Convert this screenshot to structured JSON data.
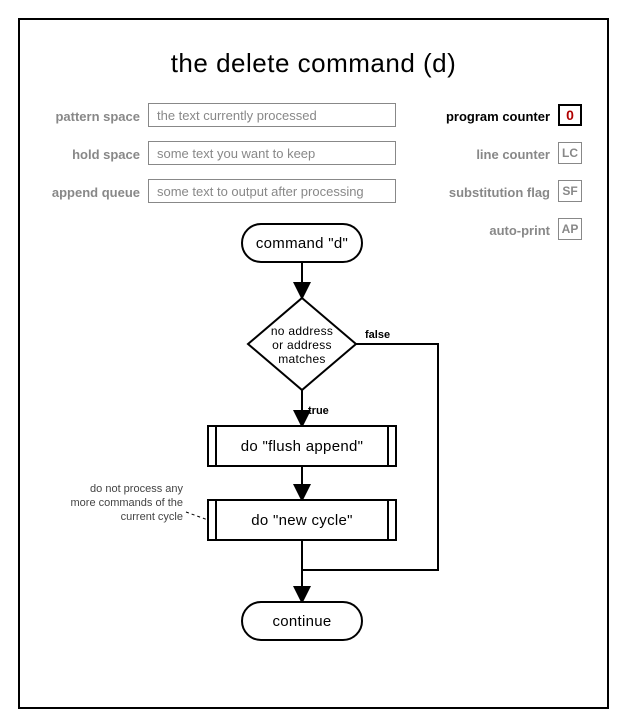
{
  "title": "the delete command (d)",
  "registers": {
    "pattern_space": {
      "label": "pattern space",
      "value": "the text currently processed"
    },
    "hold_space": {
      "label": "hold space",
      "value": "some text you want to keep"
    },
    "append_queue": {
      "label": "append queue",
      "value": "some text to output after processing"
    }
  },
  "counters": {
    "program_counter": {
      "label": "program counter",
      "value": "0",
      "active": true
    },
    "line_counter": {
      "label": "line counter",
      "value": "LC"
    },
    "substitution_flag": {
      "label": "substitution flag",
      "value": "SF"
    },
    "auto_print": {
      "label": "auto-print",
      "value": "AP"
    }
  },
  "flow": {
    "start": "command \"d\"",
    "decision_l1": "no address",
    "decision_l2": "or address",
    "decision_l3": "matches",
    "true_label": "true",
    "false_label": "false",
    "proc1": "do \"flush append\"",
    "proc2": "do \"new cycle\"",
    "end": "continue"
  },
  "annotation": "do not process any\nmore commands of the\ncurrent cycle"
}
